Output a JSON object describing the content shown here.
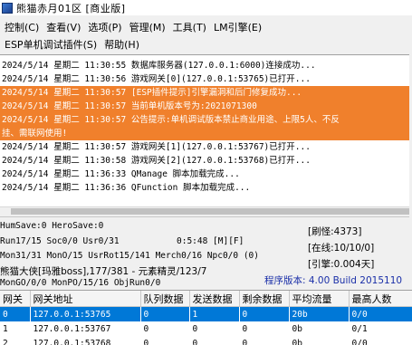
{
  "window": {
    "title": "熊猫赤月01区 [商业版]"
  },
  "menu": {
    "row1": [
      "控制(C)",
      "查看(V)",
      "选项(P)",
      "管理(M)",
      "工具(T)",
      "LM引擎(E)"
    ],
    "row2": [
      "ESP单机调试插件(S)",
      "帮助(H)"
    ]
  },
  "log": [
    {
      "text": "2024/5/14 星期二 11:30:55 数据库服务器(127.0.0.1:6000)连接成功...",
      "highlight": false
    },
    {
      "text": "2024/5/14 星期二 11:30:56 游戏网关[0](127.0.0.1:53765)已打开...",
      "highlight": false
    },
    {
      "text": "2024/5/14 星期二 11:30:57 [ESP插件提示]引擎漏洞和后门修复成功...",
      "highlight": true
    },
    {
      "text": "2024/5/14 星期二 11:30:57 当前单机版本号为:2021071300",
      "highlight": true
    },
    {
      "text": "2024/5/14 星期二 11:30:57 公告提示:单机调试版本禁止商业用途、上限5人、不反",
      "highlight": true
    },
    {
      "text": "挂、需联网使用!",
      "highlight": true
    },
    {
      "text": "2024/5/14 星期二 11:30:57 游戏网关[1](127.0.0.1:53767)已打开...",
      "highlight": false
    },
    {
      "text": "2024/5/14 星期二 11:30:58 游戏网关[2](127.0.0.1:53768)已打开...",
      "highlight": false
    },
    {
      "text": "2024/5/14 星期二 11:36:33 QManage 脚本加载完成...",
      "highlight": false
    },
    {
      "text": "2024/5/14 星期二 11:36:36 QFunction 脚本加载完成...",
      "highlight": false
    }
  ],
  "status": {
    "line1": "HumSave:0 HeroSave:0",
    "line2": "Run17/15 Soc0/0 Usr0/31",
    "line2_time": "0:5:48 [M][F]",
    "line3": "Mon31/31 MonO/15 UsrRot15/141 Merch0/16 Npc0/0 (0)",
    "line4": "熊猫大侠[玛雅boss],177/381 - 元素精灵/123/7",
    "line5": "MonGO/0/0 MonPO/15/16 ObjRun0/0",
    "refresh": "[刷怪:4373]",
    "online": "[在线:10/10/0]",
    "engine": "[引擎:0.004天]",
    "version": "程序版本: 4.00 Build 2015110"
  },
  "gateway_table": {
    "columns": [
      "网关",
      "网关地址",
      "队列数据",
      "发送数据",
      "剩余数据",
      "平均流量",
      "最高人数"
    ],
    "rows": [
      [
        "0",
        "127.0.0.1:53765",
        "0",
        "1",
        "0",
        "20b",
        "0/0"
      ],
      [
        "1",
        "127.0.0.1:53767",
        "0",
        "0",
        "0",
        "0b",
        "0/1"
      ],
      [
        "2",
        "127.0.0.1:53768",
        "0",
        "0",
        "0",
        "0b",
        "0/0"
      ]
    ]
  },
  "colors": {
    "highlight_orange": "#f0802c",
    "selection_blue": "#0078d7",
    "version_blue": "#1a2fa8"
  }
}
